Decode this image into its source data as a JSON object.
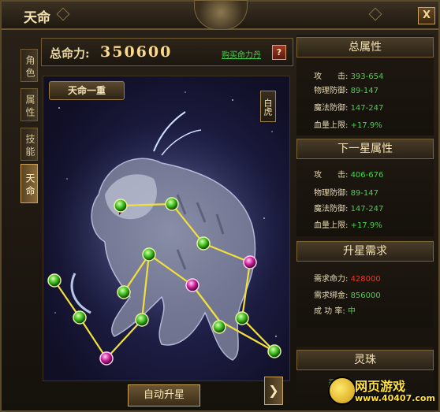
{
  "window": {
    "title": "天命",
    "close_label": "X"
  },
  "tabs": [
    {
      "label": "角色",
      "active": false
    },
    {
      "label": "属性",
      "active": false
    },
    {
      "label": "技能",
      "active": false
    },
    {
      "label": "天命",
      "active": true
    }
  ],
  "power": {
    "label": "总命力:",
    "value": "350600",
    "buy_link": "购买命力丹",
    "help": "?"
  },
  "constellation": {
    "stage": "天命一重",
    "beast": "白虎",
    "nodes": [
      {
        "id": 1,
        "color": "green"
      },
      {
        "id": 2,
        "color": "green"
      },
      {
        "id": 3,
        "color": "green"
      },
      {
        "id": 4,
        "color": "magenta"
      },
      {
        "id": 5,
        "color": "green"
      },
      {
        "id": 6,
        "color": "magenta"
      },
      {
        "id": 7,
        "color": "green"
      },
      {
        "id": 8,
        "color": "green"
      },
      {
        "id": 9,
        "color": "green"
      },
      {
        "id": 10,
        "color": "green"
      },
      {
        "id": 11,
        "color": "magenta"
      },
      {
        "id": 12,
        "color": "green"
      },
      {
        "id": 13,
        "color": "green"
      },
      {
        "id": 14,
        "color": "green"
      },
      {
        "id": 15,
        "color": "green"
      }
    ]
  },
  "buttons": {
    "auto": "自动升星",
    "next": "❯"
  },
  "total_attrs": {
    "title": "总属性",
    "rows": [
      {
        "name": "攻　　击:",
        "value": "393-654"
      },
      {
        "name": "物理防御:",
        "value": "89-147"
      },
      {
        "name": "魔法防御:",
        "value": "147-247"
      },
      {
        "name": "血量上限:",
        "value": "+17.9%"
      }
    ]
  },
  "next_attrs": {
    "title": "下一星属性",
    "rows": [
      {
        "name": "攻　　击:",
        "value": "406-676"
      },
      {
        "name": "物理防御:",
        "value": "89-147"
      },
      {
        "name": "魔法防御:",
        "value": "147-247"
      },
      {
        "name": "血量上限:",
        "value": "+17.9%"
      }
    ]
  },
  "requirements": {
    "title": "升星需求",
    "rows": [
      {
        "name": "需求命力:",
        "value": "428000",
        "color": "#e53a2a"
      },
      {
        "name": "需求绑金:",
        "value": "856000",
        "color": "#4bd04b"
      },
      {
        "name": "成 功 率:",
        "value": "中",
        "color": "#4bd04b"
      }
    ]
  },
  "pearl": {
    "title": "灵珠",
    "label": "灵珠"
  },
  "watermark": {
    "text": "网页游戏",
    "url": "www.40407.com"
  }
}
